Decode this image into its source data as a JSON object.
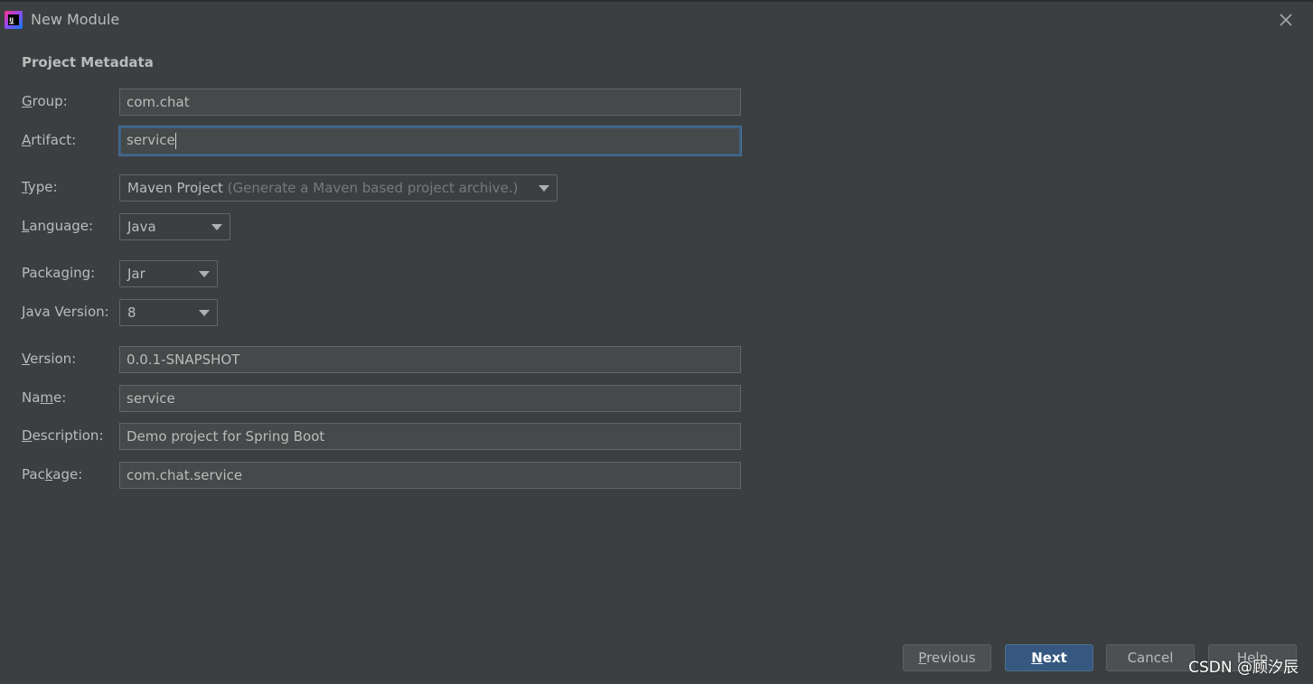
{
  "window": {
    "title": "New Module",
    "app_icon": "intellij-icon",
    "close_icon": "close-icon"
  },
  "section_title": "Project Metadata",
  "form": {
    "group": {
      "label_mn": "G",
      "label_rest": "roup:",
      "value": "com.chat"
    },
    "artifact": {
      "label_mn": "A",
      "label_rest": "rtifact:",
      "value": "service"
    },
    "type": {
      "label_mn": "T",
      "label_rest": "ype:",
      "value": "Maven Project",
      "hint": "(Generate a Maven based project archive.)"
    },
    "language": {
      "label_mn": "L",
      "label_rest": "anguage:",
      "value": "Java"
    },
    "packaging": {
      "label_pre": "Packa",
      "label_mn": "g",
      "label_rest": "ing:",
      "value": "Jar"
    },
    "java_version": {
      "label_mn": "J",
      "label_rest": "ava Version:",
      "value": "8"
    },
    "version": {
      "label_mn": "V",
      "label_rest": "ersion:",
      "value": "0.0.1-SNAPSHOT"
    },
    "name": {
      "label_pre": "Na",
      "label_mn": "m",
      "label_rest": "e:",
      "value": "service"
    },
    "description": {
      "label_mn": "D",
      "label_rest": "escription:",
      "value": "Demo project for Spring Boot"
    },
    "package": {
      "label_pre": "Pac",
      "label_mn": "k",
      "label_rest": "age:",
      "value": "com.chat.service"
    }
  },
  "buttons": {
    "previous": {
      "mn": "P",
      "rest": "revious"
    },
    "next": {
      "mn": "N",
      "rest": "ext"
    },
    "cancel": {
      "label": "Cancel"
    },
    "help": {
      "label": "Help"
    }
  },
  "watermark": "CSDN @顾汐辰",
  "colors": {
    "background": "#3c3f41",
    "field_bg": "#45494a",
    "focus_border": "#3d6185",
    "default_button": "#365880"
  }
}
